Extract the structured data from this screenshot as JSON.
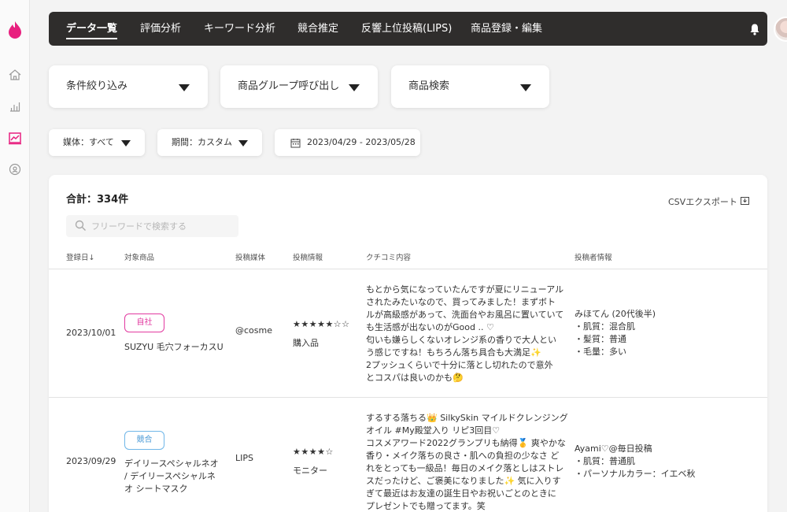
{
  "nav": {
    "tabs": [
      {
        "label": "データ一覧",
        "active": true
      },
      {
        "label": "評価分析"
      },
      {
        "label": "キーワード分析"
      },
      {
        "label": "競合推定"
      },
      {
        "label": "反響上位投稿(LIPS)"
      },
      {
        "label": "商品登録・編集"
      }
    ]
  },
  "filters": {
    "conditions": "条件絞り込み",
    "product_group": "商品グループ呼び出し",
    "product_search": "商品検索",
    "media": "媒体：すべて",
    "period": "期間：カスタム",
    "date_range": "2023/04/29 - 2023/05/28"
  },
  "table": {
    "total": "合計：334件",
    "csv_export": "CSVエクスポート",
    "search_placeholder": "フリーワードで検索する",
    "headers": [
      "登録日↓",
      "対象商品",
      "投稿媒体",
      "投稿情報",
      "クチコミ内容",
      "投稿者情報"
    ],
    "rows": [
      {
        "date": "2023/10/01",
        "tag": "自社",
        "product": [
          "SUZYU 毛穴フォーカスU"
        ],
        "media": "@cosme",
        "stars": "★★★★★☆☆",
        "purchase": "購入品",
        "review": [
          "もとから気になっていたんですが夏にリニューアル",
          "されたみたいなので、買ってみました！まずボト",
          "ルが高級感があって、洗面台やお風呂に置いていて",
          "も生活感が出ないのがGood .. ♡",
          "匂いも嫌らしくないオレンジ系の香りで大人とい",
          "う感じですね！もちろん落ち具合も大満足✨",
          "2プッシュくらいで十分に落とし切れたので意外",
          "とコスパは良いのかも🤔"
        ],
        "author": [
          "みほてん (20代後半)",
          "・肌質：混合肌",
          "・髪質：普通",
          "・毛量：多い"
        ]
      },
      {
        "date": "2023/09/29",
        "tag": "競合",
        "product": [
          "デイリースペシャルネオ",
          "/ デイリースペシャルネ",
          "オ シートマスク"
        ],
        "media": "LIPS",
        "stars": "★★★★☆",
        "purchase": "モニター",
        "review": [
          "するする落ちる👑 SilkySkin マイルドクレンジング",
          "オイル #My殿堂入り リピ3回目♡",
          "コスメアワード2022グランプリも納得🥇 爽やかな",
          "香り・メイク落ちの良さ・肌への負担の少なさ ど",
          "れをとっても一級品！毎日のメイク落としはストレ",
          "スだったけど、ご褒美になりました✨ 気に入りす",
          "ぎて最近はお友達の誕生日やお祝いごとのときに",
          "プレゼントでも贈ってます。笑"
        ],
        "author": [
          "Ayami♡@毎日投稿",
          "・肌質：普通肌",
          "・パーソナルカラー：イエベ秋"
        ]
      }
    ]
  },
  "colors": {
    "nav_bg": "#2f2d2c",
    "brand": "#e8207f",
    "own_tag": "#e23aa0",
    "rival_tag": "#6fb6e8"
  }
}
